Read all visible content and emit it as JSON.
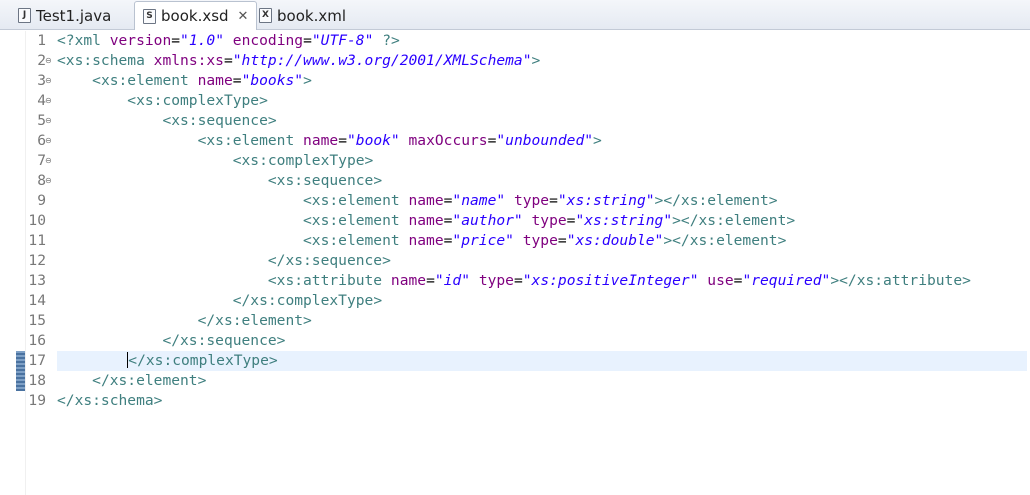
{
  "tabs": [
    {
      "icon": "J",
      "label": "Test1.java",
      "active": false
    },
    {
      "icon": "S",
      "label": "book.xsd",
      "active": true,
      "close": "✕"
    },
    {
      "icon": "X",
      "label": "book.xml",
      "active": false
    }
  ],
  "editor": {
    "current_line": 17,
    "lines": [
      {
        "n": "1",
        "fold": "",
        "text": "<?xml version=\"1.0\" encoding=\"UTF-8\" ?>"
      },
      {
        "n": "2",
        "fold": "⊖",
        "text": "<xs:schema xmlns:xs=\"http://www.w3.org/2001/XMLSchema\">"
      },
      {
        "n": "3",
        "fold": "⊖",
        "text": "    <xs:element name=\"books\">"
      },
      {
        "n": "4",
        "fold": "⊖",
        "text": "        <xs:complexType>"
      },
      {
        "n": "5",
        "fold": "⊖",
        "text": "            <xs:sequence>"
      },
      {
        "n": "6",
        "fold": "⊖",
        "text": "                <xs:element name=\"book\" maxOccurs=\"unbounded\">"
      },
      {
        "n": "7",
        "fold": "⊖",
        "text": "                    <xs:complexType>"
      },
      {
        "n": "8",
        "fold": "⊖",
        "text": "                        <xs:sequence>"
      },
      {
        "n": "9",
        "fold": "",
        "text": "                            <xs:element name=\"name\" type=\"xs:string\"></xs:element>"
      },
      {
        "n": "10",
        "fold": "",
        "text": "                            <xs:element name=\"author\" type=\"xs:string\"></xs:element>"
      },
      {
        "n": "11",
        "fold": "",
        "text": "                            <xs:element name=\"price\" type=\"xs:double\"></xs:element>"
      },
      {
        "n": "12",
        "fold": "",
        "text": "                        </xs:sequence>"
      },
      {
        "n": "13",
        "fold": "",
        "text": "                        <xs:attribute name=\"id\" type=\"xs:positiveInteger\" use=\"required\"></xs:attribute>"
      },
      {
        "n": "14",
        "fold": "",
        "text": "                    </xs:complexType>"
      },
      {
        "n": "15",
        "fold": "",
        "text": "                </xs:element>"
      },
      {
        "n": "16",
        "fold": "",
        "text": "            </xs:sequence>"
      },
      {
        "n": "17",
        "fold": "",
        "text": "        </xs:complexType>"
      },
      {
        "n": "18",
        "fold": "",
        "text": "    </xs:element>"
      },
      {
        "n": "19",
        "fold": "",
        "text": "</xs:schema>"
      }
    ]
  },
  "colors": {
    "tag": "#3f7f7f",
    "attribute": "#7f007f",
    "value": "#2a00ff",
    "current_line": "#e8f2fe",
    "line_number": "#787878"
  }
}
